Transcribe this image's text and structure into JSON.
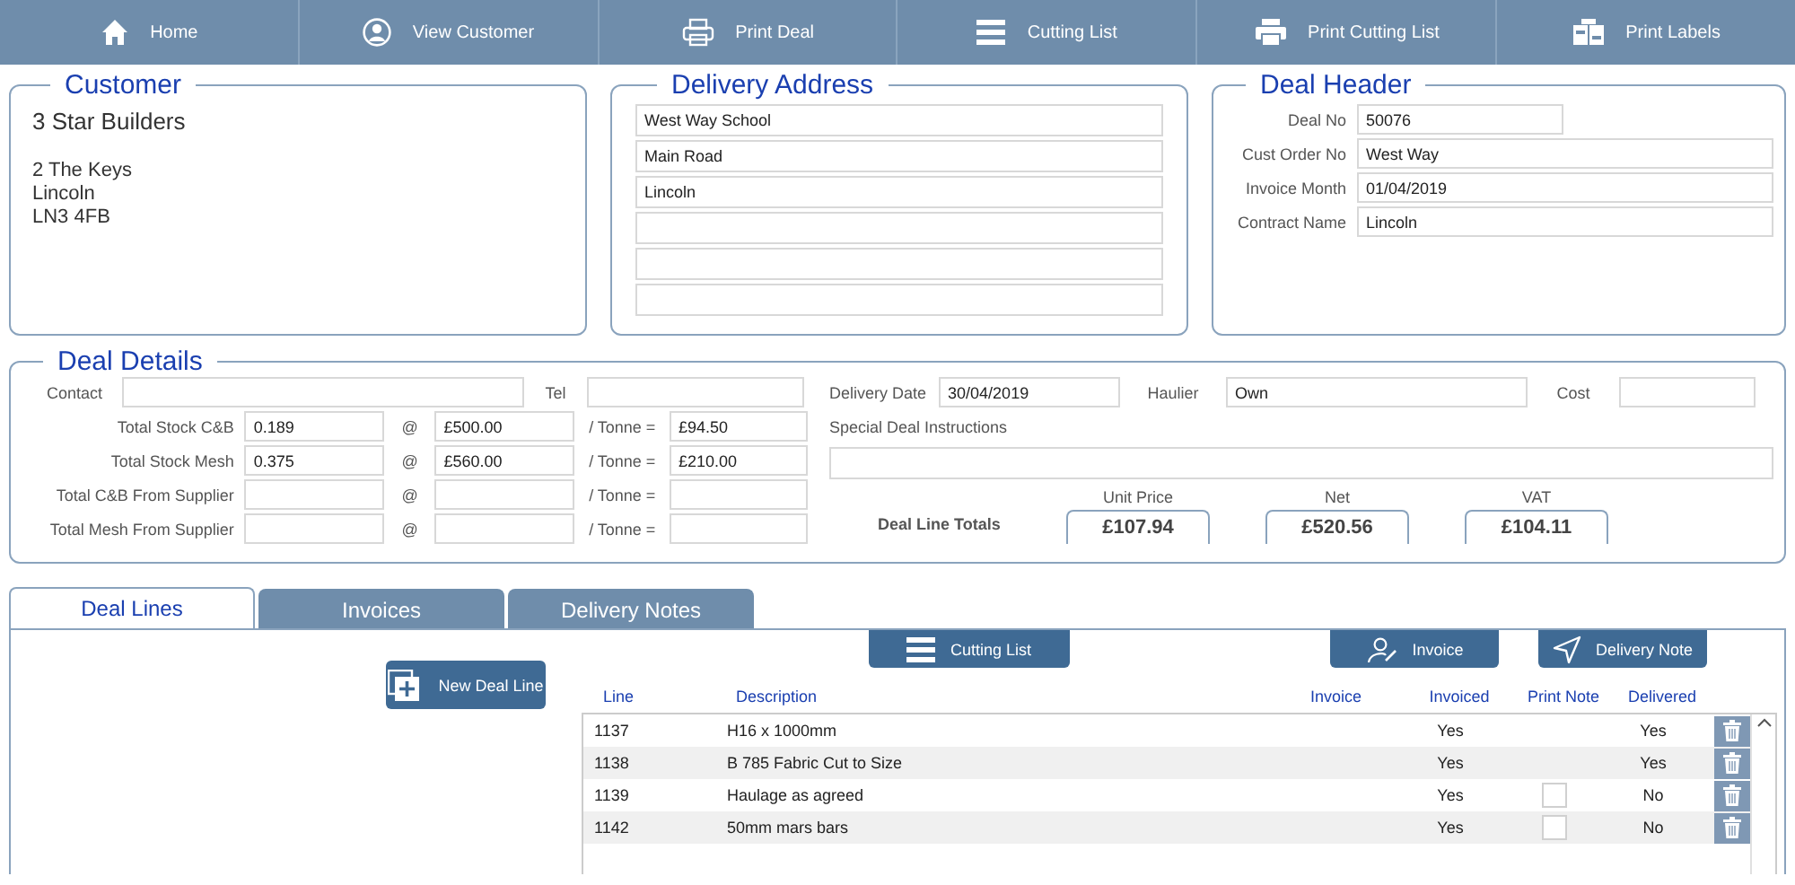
{
  "toolbar": [
    {
      "label": "Home",
      "kind": "home"
    },
    {
      "label": "View Customer",
      "kind": "person"
    },
    {
      "label": "Print Deal",
      "kind": "printer"
    },
    {
      "label": "Cutting List",
      "kind": "lines"
    },
    {
      "label": "Print Cutting List",
      "kind": "printer-solid"
    },
    {
      "label": "Print  Labels",
      "kind": "labels"
    }
  ],
  "customer": {
    "title": "Customer",
    "name": "3 Star Builders",
    "address": [
      "2 The Keys",
      "Lincoln",
      "LN3 4FB"
    ]
  },
  "delivery_address": {
    "title": "Delivery Address",
    "lines": [
      "West Way School",
      "Main Road",
      "Lincoln"
    ]
  },
  "deal_header": {
    "title": "Deal Header",
    "fields": [
      {
        "label": "Deal No",
        "value": "50076",
        "kind": "short"
      },
      {
        "label": "Cust Order No",
        "value": "West Way",
        "kind": "wide"
      },
      {
        "label": "Invoice Month",
        "value": "01/04/2019",
        "kind": "wide"
      },
      {
        "label": "Contract Name",
        "value": "Lincoln",
        "kind": "wide"
      }
    ]
  },
  "deal_details": {
    "title": "Deal Details",
    "contact": {
      "label": "Contact"
    },
    "tel": {
      "label": "Tel"
    },
    "stock_rows": [
      {
        "label": "Total Stock C&B",
        "qty": "0.189",
        "at": "@",
        "price": "£500.00",
        "per": "/ Tonne =",
        "total": "£94.50"
      },
      {
        "label": "Total Stock Mesh",
        "qty": "0.375",
        "at": "@",
        "price": "£560.00",
        "per": "/ Tonne =",
        "total": "£210.00"
      },
      {
        "label": "Total C&B From Supplier",
        "at": "@",
        "per": "/ Tonne ="
      },
      {
        "label": "Total Mesh From Supplier",
        "at": "@",
        "per": "/ Tonne ="
      }
    ],
    "delivery_date": {
      "label": "Delivery Date",
      "value": "30/04/2019"
    },
    "haulier": {
      "label": "Haulier",
      "value": "Own"
    },
    "cost": {
      "label": "Cost"
    },
    "instructions": {
      "label": "Special Deal Instructions"
    },
    "totals_label": "Deal Line Totals",
    "totals": [
      {
        "label": "Unit Price",
        "value": "£107.94"
      },
      {
        "label": "Net",
        "value": "£520.56"
      },
      {
        "label": "VAT",
        "value": "£104.11"
      }
    ]
  },
  "tabs": [
    {
      "label": "Deal Lines",
      "selected": true
    },
    {
      "label": "Invoices",
      "selected": false
    },
    {
      "label": "Delivery Notes",
      "selected": false
    }
  ],
  "new_line_button": "New Deal Line",
  "actions": [
    {
      "label": "Cutting List",
      "kind": "lines"
    },
    {
      "label": "Invoice",
      "kind": "sign"
    },
    {
      "label": "Delivery Note",
      "kind": "send"
    }
  ],
  "table": {
    "columns": [
      "Line",
      "Description",
      "Invoice",
      "Invoiced",
      "Print Note",
      "Delivered"
    ],
    "rows": [
      {
        "line": "1137",
        "description": "H16 x 1000mm",
        "invoiced": "Yes",
        "delivered": "Yes"
      },
      {
        "line": "1138",
        "description": "B 785 Fabric Cut to Size",
        "invoiced": "Yes",
        "delivered": "Yes"
      },
      {
        "line": "1139",
        "description": "Haulage as agreed",
        "invoiced": "Yes",
        "print_note_checked": false,
        "delivered": "No"
      },
      {
        "line": "1142",
        "description": "50mm mars bars",
        "invoiced": "Yes",
        "print_note_checked": false,
        "delivered": "No"
      }
    ]
  }
}
